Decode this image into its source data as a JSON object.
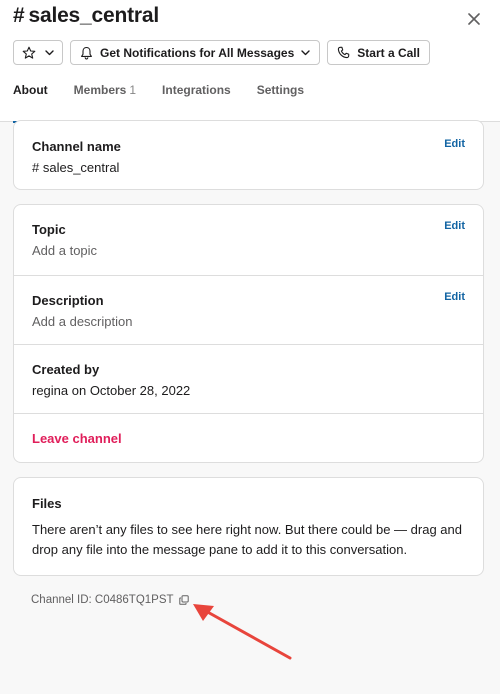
{
  "header": {
    "title": "sales_central",
    "hash": "#"
  },
  "toolbar": {
    "notifications_label": "Get Notifications for All Messages",
    "call_label": "Start a Call"
  },
  "tabs": [
    {
      "label": "About",
      "count": ""
    },
    {
      "label": "Members",
      "count": "1"
    },
    {
      "label": "Integrations",
      "count": ""
    },
    {
      "label": "Settings",
      "count": ""
    }
  ],
  "channel_name": {
    "label": "Channel name",
    "value": "# sales_central",
    "edit": "Edit"
  },
  "topic": {
    "label": "Topic",
    "value": "Add a topic",
    "edit": "Edit"
  },
  "description": {
    "label": "Description",
    "value": "Add a description",
    "edit": "Edit"
  },
  "created_by": {
    "label": "Created by",
    "value": "regina on October 28, 2022"
  },
  "leave": {
    "label": "Leave channel"
  },
  "files": {
    "label": "Files",
    "text": "There aren’t any files to see here right now. But there could be — drag and drop any file into the message pane to add it to this conversation."
  },
  "channel_id": {
    "text": "Channel ID: C0486TQ1PST"
  },
  "colors": {
    "accent": "#1264a3",
    "danger": "#e01e5a",
    "annotation": "#e8453c"
  },
  "icons": {
    "close": "close-icon",
    "star": "star-icon",
    "bell": "bell-icon",
    "phone": "phone-icon",
    "copy": "copy-icon"
  }
}
